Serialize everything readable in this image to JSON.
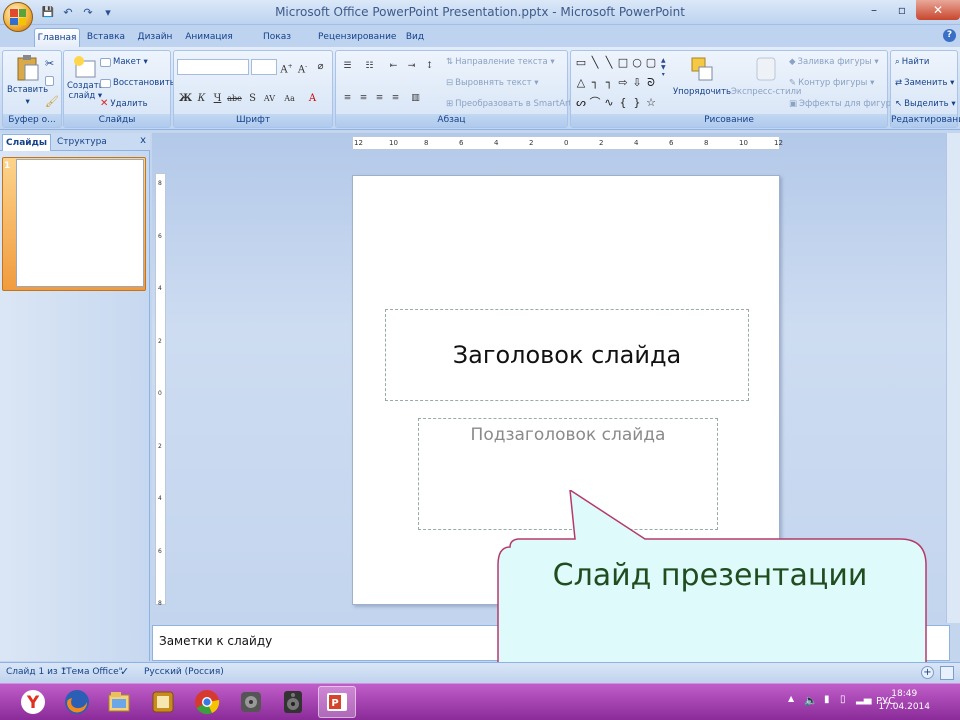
{
  "window": {
    "title": "Microsoft Office PowerPoint Presentation.pptx - Microsoft PowerPoint",
    "controls": {
      "minimize": "–",
      "maximize": "▫",
      "close": "✕"
    }
  },
  "quick_access": {
    "save": "💾",
    "undo": "↶",
    "redo": "↷",
    "customize": "▾"
  },
  "tabs": [
    "Главная",
    "Вставка",
    "Дизайн",
    "Анимация",
    "Показ слайдов",
    "Рецензирование",
    "Вид"
  ],
  "ribbon": {
    "clipboard": {
      "label": "Буфер о...",
      "paste": "Вставить",
      "cut": "✂"
    },
    "slides": {
      "label": "Слайды",
      "new_slide": "Создать",
      "new_slide2": "слайд ▾",
      "layout": "Макет ▾",
      "reset": "Восстановить",
      "delete": "Удалить"
    },
    "font": {
      "label": "Шрифт",
      "font_name": "",
      "font_size": ""
    },
    "paragraph": {
      "label": "Абзац",
      "text_direction": "Направление текста ▾",
      "align_text": "Выровнять текст ▾",
      "convert_smartart": "Преобразовать в SmartArt ▾"
    },
    "drawing": {
      "label": "Рисование",
      "arrange": "Упорядочить",
      "quick_styles": "Экспресс-стили",
      "shape_fill": "Заливка фигуры ▾",
      "shape_outline": "Контур фигуры ▾",
      "shape_effects": "Эффекты для фигур ▾"
    },
    "editing": {
      "label": "Редактирование",
      "find": "Найти",
      "replace": "Заменить ▾",
      "select": "Выделить ▾"
    }
  },
  "pane": {
    "tab_slides": "Слайды",
    "tab_outline": "Структура",
    "close": "x",
    "thumb_number": "1"
  },
  "ruler": {
    "horizontal": [
      "12",
      "10",
      "8",
      "6",
      "4",
      "2",
      "0",
      "2",
      "4",
      "6",
      "8",
      "10",
      "12"
    ],
    "vertical": [
      "8",
      "6",
      "4",
      "2",
      "0",
      "2",
      "4",
      "6",
      "8"
    ]
  },
  "slide": {
    "title_placeholder": "Заголовок слайда",
    "subtitle_placeholder": "Подзаголовок слайда"
  },
  "notes": {
    "placeholder": "Заметки к слайду"
  },
  "callout": {
    "text": "Слайд презентации",
    "fill": "#dffafa",
    "stroke": "#b53a6a"
  },
  "status": {
    "slide_count": "Слайд 1 из 1",
    "theme": "\"Тема Office\"",
    "language": "Русский (Россия)",
    "zoom_plus": "+"
  },
  "taskbar": {
    "apps": [
      "yandex-browser-icon",
      "firefox-icon",
      "file-manager-icon",
      "gallery-icon",
      "chrome-icon",
      "media-icon",
      "speaker-icon",
      "powerpoint-icon"
    ],
    "language": "РУС",
    "time": "18:49",
    "date": "17.04.2014"
  },
  "colors": {
    "accent": "#15428b",
    "taskbar": "#a447b3",
    "ribbon": "#c7daf2"
  }
}
